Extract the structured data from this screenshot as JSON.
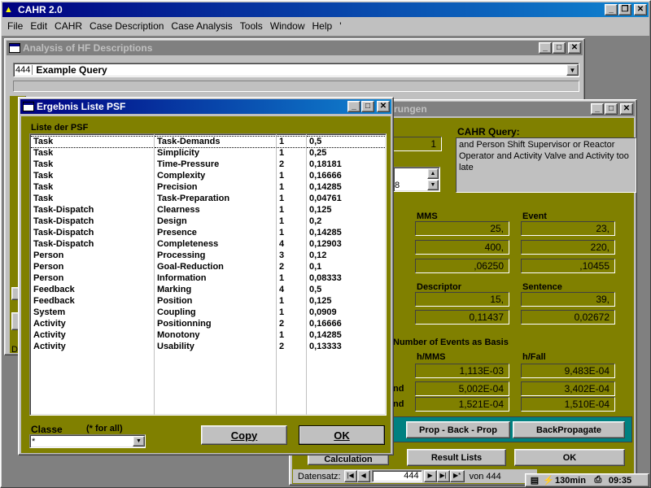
{
  "app": {
    "title": "CAHR 2.0"
  },
  "menu": [
    "File",
    "Edit",
    "CAHR",
    "Case Description",
    "Case Analysis",
    "Tools",
    "Window",
    "Help",
    "'"
  ],
  "analysis": {
    "title": "Analysis of HF Descriptions",
    "query_id": "444",
    "query_name": "Example Query",
    "visible_letters": [
      "D",
      "i",
      "D"
    ]
  },
  "back": {
    "title_fragment": "rungen",
    "count_value": "1",
    "spinner_value": "8",
    "query_label": "CAHR Query:",
    "query_text": "and Person Shift Supervisor or Reactor Operator and Activity Valve and Activity too late",
    "mms_label": "MMS",
    "event_label": "Event",
    "mms_values": [
      "25,",
      "400,",
      ",06250"
    ],
    "event_values": [
      "23,",
      "220,",
      ",10455"
    ],
    "descriptor_label": "Descriptor",
    "sentence_label": "Sentence",
    "descriptor_values": [
      "15,",
      "0,11437"
    ],
    "sentence_values": [
      "39,",
      "0,02672"
    ],
    "basis_label": "Number of Events as Basis",
    "h_mms_label": "h/MMS",
    "h_fall_label": "h/Fall",
    "row_suffixes": [
      "",
      "nd",
      "nd"
    ],
    "h_mms_values": [
      "1,113E-03",
      "5,002E-04",
      "1,521E-04"
    ],
    "h_fall_values": [
      "9,483E-04",
      "3,402E-04",
      "1,510E-04"
    ],
    "btn_prop": "Prop - Back - Prop",
    "btn_backprop": "BackPropagate",
    "btn_calculation": "Calculation",
    "btn_result_lists": "Result Lists",
    "btn_ok": "OK",
    "datensatz_label": "Datensatz:",
    "datensatz_value": "444",
    "von_label": "von 444"
  },
  "psf": {
    "title": "Ergebnis Liste PSF",
    "list_label": "Liste der PSF",
    "rows": [
      [
        "Task",
        "Task-Demands",
        "1",
        "0,5"
      ],
      [
        "Task",
        "Simplicity",
        "1",
        "0,25"
      ],
      [
        "Task",
        "Time-Pressure",
        "2",
        "0,18181"
      ],
      [
        "Task",
        "Complexity",
        "1",
        "0,16666"
      ],
      [
        "Task",
        "Precision",
        "1",
        "0,14285"
      ],
      [
        "Task",
        "Task-Preparation",
        "1",
        "0,04761"
      ],
      [
        "Task-Dispatch",
        "Clearness",
        "1",
        "0,125"
      ],
      [
        "Task-Dispatch",
        "Design",
        "1",
        "0,2"
      ],
      [
        "Task-Dispatch",
        "Presence",
        "1",
        "0,14285"
      ],
      [
        "Task-Dispatch",
        "Completeness",
        "4",
        "0,12903"
      ],
      [
        "Person",
        "Processing",
        "3",
        "0,12"
      ],
      [
        "Person",
        "Goal-Reduction",
        "2",
        "0,1"
      ],
      [
        "Person",
        "Information",
        "1",
        "0,08333"
      ],
      [
        "Feedback",
        "Marking",
        "4",
        "0,5"
      ],
      [
        "Feedback",
        "Position",
        "1",
        "0,125"
      ],
      [
        "System",
        "Coupling",
        "1",
        "0,0909"
      ],
      [
        "Activity",
        "Positionning",
        "2",
        "0,16666"
      ],
      [
        "Activity",
        "Monotony",
        "1",
        "0,14285"
      ],
      [
        "Activity",
        "Usability",
        "2",
        "0,13333"
      ]
    ],
    "classe_label": "Classe",
    "classe_hint": "(* for all)",
    "classe_value": "*",
    "copy_label": "Copy",
    "ok_label": "OK"
  },
  "taskbar": {
    "time_value": "130min",
    "clock": "09:35"
  }
}
